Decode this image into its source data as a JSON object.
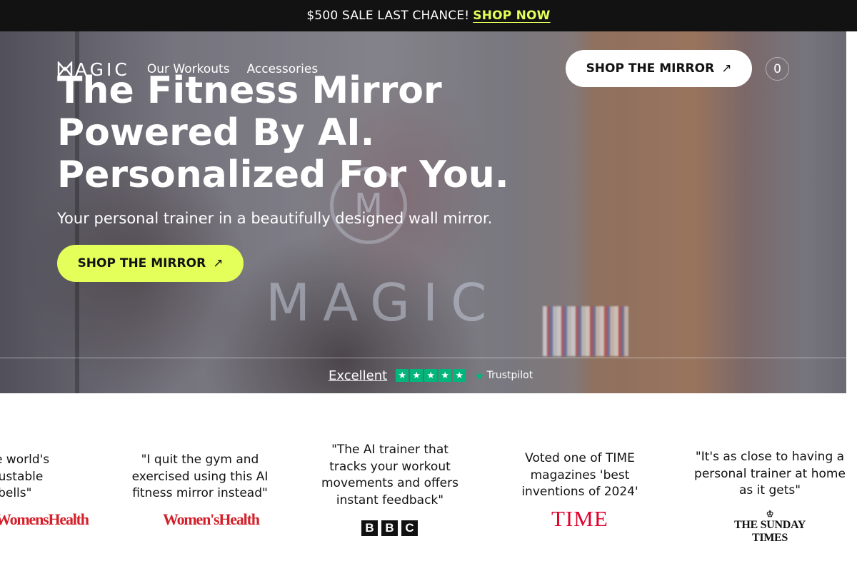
{
  "promo": {
    "text": "$500 SALE LAST CHANCE!",
    "link": "SHOP NOW",
    "accent": "#e4ff5a"
  },
  "nav": {
    "logo": "AGIC",
    "items": [
      {
        "label": "Our Workouts"
      },
      {
        "label": "Accessories"
      }
    ],
    "shop_button": "SHOP THE MIRROR",
    "cart_count": "0"
  },
  "hero": {
    "headline_1": "The Fitness Mirror",
    "headline_2": "Powered By AI.",
    "headline_3": "Personalized For You.",
    "subline": "Your personal trainer in a beautifully designed wall mirror.",
    "cta": "SHOP THE MIRROR",
    "cta_color": "#e4ff5a",
    "arrow_icon": "arrow-up-right-icon"
  },
  "trust": {
    "label": "Excellent",
    "rating_stars": 5,
    "brand": "Trustpilot",
    "star_color": "#00b67a"
  },
  "press": [
    {
      "quote_line_1": "as the world's",
      "quote_line_2": "t adjustable",
      "quote_line_3": "nbbells\"",
      "publication": "WomensHealth"
    },
    {
      "quote": "\"I quit the gym and exercised using this AI fitness mirror instead\"",
      "publication": "Women'sHealth"
    },
    {
      "quote": "\"The AI trainer that tracks your workout movements and offers instant feedback\"",
      "publication": "BBC"
    },
    {
      "quote": "Voted one of TIME magazines 'best inventions of 2024'",
      "publication": "TIME"
    },
    {
      "quote": "\"It's as close to having a personal trainer at home as it gets\"",
      "publication": "THE SUNDAY TIMES"
    }
  ]
}
